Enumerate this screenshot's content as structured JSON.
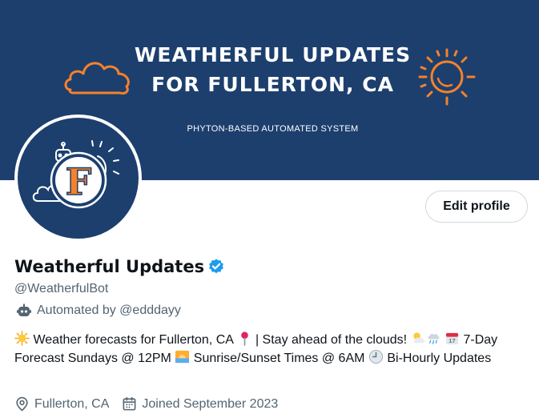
{
  "banner": {
    "title_line1": "WEATHERFUL UPDATES",
    "title_line2": "FOR FULLERTON, CA",
    "subtitle": "PHYTON-BASED AUTOMATED SYSTEM",
    "accent_color": "#f5822a",
    "background_color": "#1c3f6e"
  },
  "avatar": {
    "letter": "F"
  },
  "buttons": {
    "edit_profile": "Edit profile"
  },
  "profile": {
    "name": "Weatherful Updates",
    "handle": "@WeatherfulBot",
    "automated_by": "Automated by @edddayy",
    "bio_segments": [
      "Weather forecasts for Fullerton, CA",
      "| Stay ahead of the clouds!",
      "7-Day Forecast Sundays @ 12PM",
      "Sunrise/Sunset Times @ 6AM",
      "Bi-Hourly Updates"
    ],
    "location": "Fullerton, CA",
    "joined": "Joined September 2023"
  },
  "icons": {
    "verified": "verified-badge-icon",
    "bot": "robot-icon",
    "location": "location-pin-icon",
    "calendar": "calendar-icon"
  },
  "colors": {
    "verified": "#1d9bf0",
    "secondary_text": "#536471"
  }
}
